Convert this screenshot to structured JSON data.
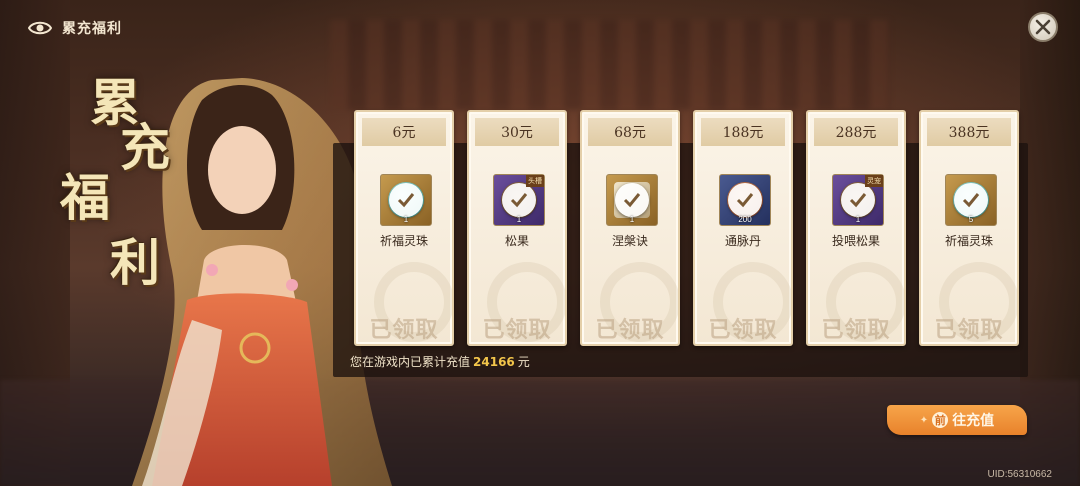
{
  "header": {
    "title": "累充福利"
  },
  "banner": {
    "title_chars": [
      "累",
      "充",
      "福",
      "利"
    ]
  },
  "cards": [
    {
      "price": "6元",
      "item_name": "祈福灵珠",
      "qty": "1",
      "tag": "",
      "icon": "orb-icon",
      "bg": "gold",
      "status": "已领取"
    },
    {
      "price": "30元",
      "item_name": "松果",
      "qty": "1",
      "tag": "头槽",
      "icon": "pinecone-icon",
      "bg": "purple",
      "status": "已领取"
    },
    {
      "price": "68元",
      "item_name": "涅槃诀",
      "qty": "1",
      "tag": "",
      "icon": "scroll-icon",
      "bg": "gold",
      "status": "已领取"
    },
    {
      "price": "188元",
      "item_name": "通脉丹",
      "qty": "200",
      "tag": "",
      "icon": "pill-icon",
      "bg": "blue",
      "status": "已领取"
    },
    {
      "price": "288元",
      "item_name": "投喂松果",
      "qty": "1",
      "tag": "灵宠",
      "icon": "pinecone-icon",
      "bg": "purple",
      "status": "已领取"
    },
    {
      "price": "388元",
      "item_name": "祈福灵珠",
      "qty": "5",
      "tag": "",
      "icon": "orb-icon",
      "bg": "gold",
      "status": "已领取"
    }
  ],
  "summary": {
    "prefix": "您在游戏内已累计充值",
    "amount": "24166",
    "unit": "元"
  },
  "action": {
    "label": "往充值",
    "bullet": "前"
  },
  "footer": {
    "uid": "UID:56310662"
  },
  "colors": {
    "accent": "#e8822b",
    "amount": "#f3c64b",
    "card_bg": "#f6ecdb"
  }
}
